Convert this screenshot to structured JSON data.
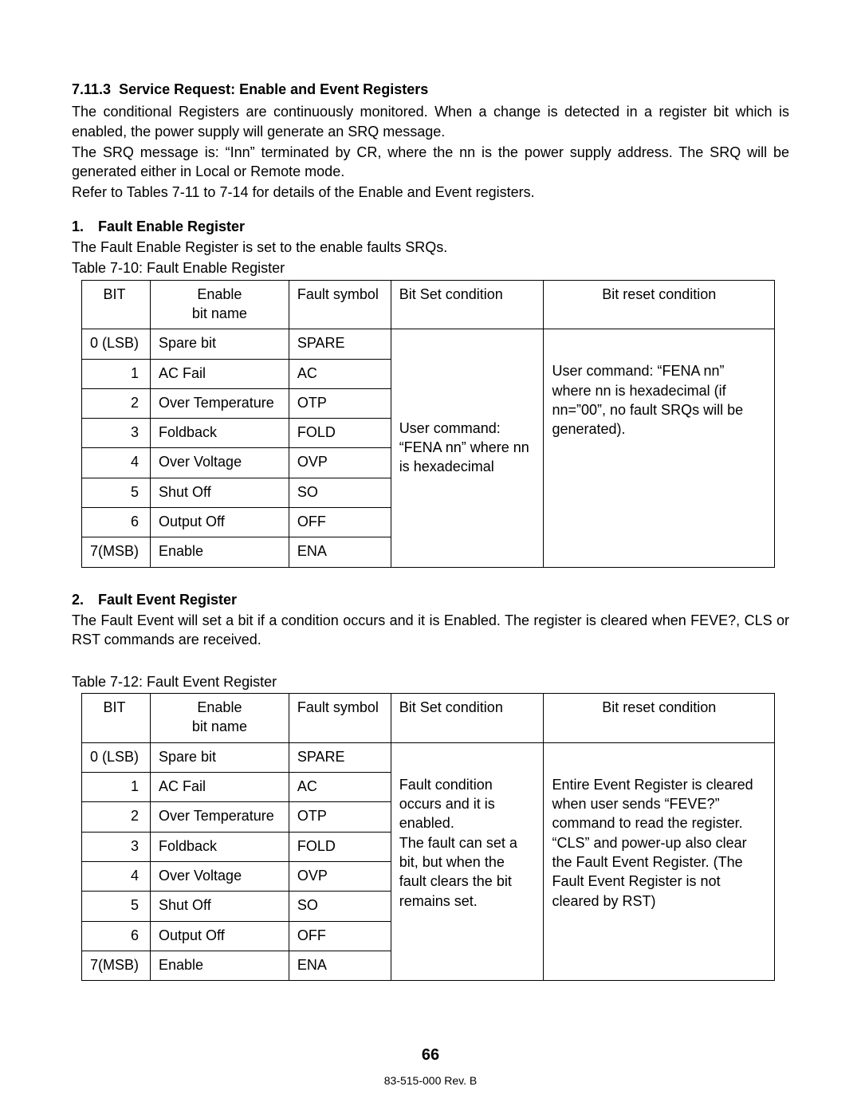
{
  "section": {
    "number": "7.11.3",
    "title": "Service Request: Enable and Event Registers",
    "para1": "The conditional Registers are continuously monitored. When a change is detected in a register bit which is enabled, the power supply will generate an SRQ message.",
    "para2": "The SRQ message is: “Inn” terminated by CR, where the nn is the power supply address. The SRQ will be generated either in Local or Remote mode.",
    "para3": "Refer to Tables 7-11 to 7-14 for details of the Enable and Event registers."
  },
  "sub1": {
    "num": "1.",
    "title": "Fault Enable Register",
    "desc": "The Fault Enable Register is set to the enable faults SRQs.",
    "caption": "Table 7-10: Fault Enable Register"
  },
  "table1": {
    "head": {
      "bit": "BIT",
      "name_top": "Enable",
      "name_bot": "bit name",
      "sym": "Fault symbol",
      "set": "Bit Set condition",
      "reset": "Bit reset condition"
    },
    "rows": [
      {
        "bit": "0 (LSB)",
        "name": "Spare bit",
        "sym": "SPARE"
      },
      {
        "bit": "1",
        "name": "AC Fail",
        "sym": "AC"
      },
      {
        "bit": "2",
        "name": "Over Temperature",
        "sym": "OTP"
      },
      {
        "bit": "3",
        "name": "Foldback",
        "sym": "FOLD"
      },
      {
        "bit": "4",
        "name": "Over Voltage",
        "sym": "OVP"
      },
      {
        "bit": "5",
        "name": "Shut Off",
        "sym": "SO"
      },
      {
        "bit": "6",
        "name": "Output Off",
        "sym": "OFF"
      },
      {
        "bit": "7(MSB)",
        "name": "Enable",
        "sym": "ENA"
      }
    ],
    "set_span": "User command: “FENA nn” where nn is hexadecimal",
    "reset_span": "User command: “FENA nn” where nn is hexadecimal (if nn=”00”, no fault SRQs will be generated)."
  },
  "sub2": {
    "num": "2.",
    "title": "Fault Event Register",
    "desc": "The Fault Event will set a bit if a condition occurs and it is Enabled. The register is cleared when FEVE?, CLS or RST commands are received.",
    "caption": "Table 7-12: Fault Event Register"
  },
  "table2": {
    "head": {
      "bit": "BIT",
      "name_top": "Enable",
      "name_bot": "bit name",
      "sym": "Fault symbol",
      "set": "Bit Set condition",
      "reset": "Bit reset condition"
    },
    "rows": [
      {
        "bit": "0 (LSB)",
        "name": "Spare bit",
        "sym": "SPARE"
      },
      {
        "bit": "1",
        "name": "AC Fail",
        "sym": "AC"
      },
      {
        "bit": "2",
        "name": "Over Temperature",
        "sym": "OTP"
      },
      {
        "bit": "3",
        "name": "Foldback",
        "sym": "FOLD"
      },
      {
        "bit": "4",
        "name": "Over Voltage",
        "sym": "OVP"
      },
      {
        "bit": "5",
        "name": "Shut Off",
        "sym": "SO"
      },
      {
        "bit": "6",
        "name": "Output Off",
        "sym": "OFF"
      },
      {
        "bit": "7(MSB)",
        "name": "Enable",
        "sym": "ENA"
      }
    ],
    "set_span": "Fault condition occurs and it is enabled.\nThe fault can set a bit, but when the fault clears the bit remains set.",
    "reset_span": "Entire Event Register is cleared when user sends “FEVE?” command to read the register.\n“CLS” and power-up also clear the Fault Event Register. (The Fault Event Register is not cleared by RST)"
  },
  "page_number": "66",
  "doc_rev": "83-515-000 Rev. B"
}
